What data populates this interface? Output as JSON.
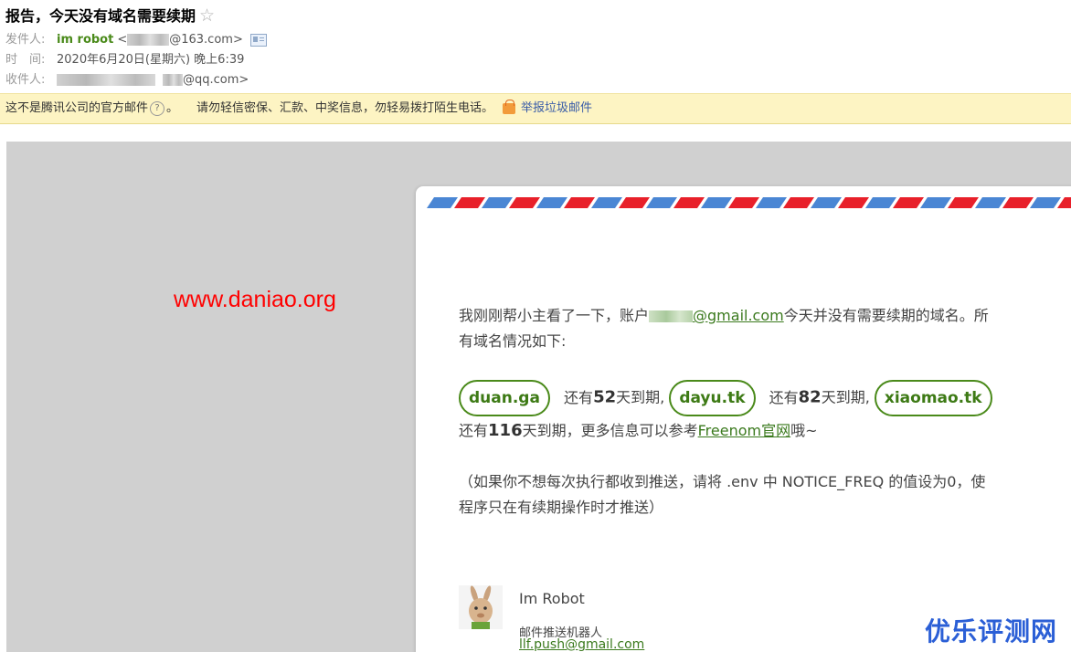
{
  "header": {
    "subject": "报告，今天没有域名需要续期",
    "star_glyph": "☆",
    "from_label": "发件人:",
    "from_name": "im robot",
    "from_open": "<",
    "from_domain": "@163.com>",
    "time_label": "时　间:",
    "time_value": "2020年6月20日(星期六) 晚上6:39",
    "to_label": "收件人:",
    "to_domain": "@qq.com>"
  },
  "warning": {
    "text1": "这不是腾讯公司的官方邮件",
    "help_glyph": "?",
    "text1_end": "。",
    "text2": "请勿轻信密保、汇款、中奖信息，勿轻易拨打陌生电话。",
    "report_label": "举报垃圾邮件"
  },
  "watermark": "www.daniao.org",
  "letter": {
    "intro_1": "我刚刚帮小主看了一下，账户",
    "intro_email": "@gmail.com",
    "intro_2": "今天并没有需要续期的域名。所",
    "intro_3": "有域名情况如下:",
    "domains": [
      {
        "name": "duan.ga",
        "pre": "还有",
        "days": "52",
        "post": "天到期,"
      },
      {
        "name": "dayu.tk",
        "pre": "还有",
        "days": "82",
        "post": "天到期,"
      },
      {
        "name": "xiaomao.tk",
        "pre": "还有",
        "days": "116",
        "post": "天到期，更多信息可以参考"
      }
    ],
    "freenom_link": "Freenom官网",
    "ending": "哦~",
    "note_1": "（如果你不想每次执行都收到推送，请将 .env 中 NOTICE_FREQ 的值设为0，使",
    "note_2": "程序只在有续期操作时才推送）"
  },
  "signature": {
    "name": "Im Robot",
    "role": "邮件推送机器人",
    "email": "llf.push@gmail.com"
  },
  "corner_watermark": "优乐评测网",
  "colors": {
    "stripe_blue": "#4a86d4",
    "stripe_red": "#e8202a",
    "accent_green": "#4a8a1a"
  }
}
